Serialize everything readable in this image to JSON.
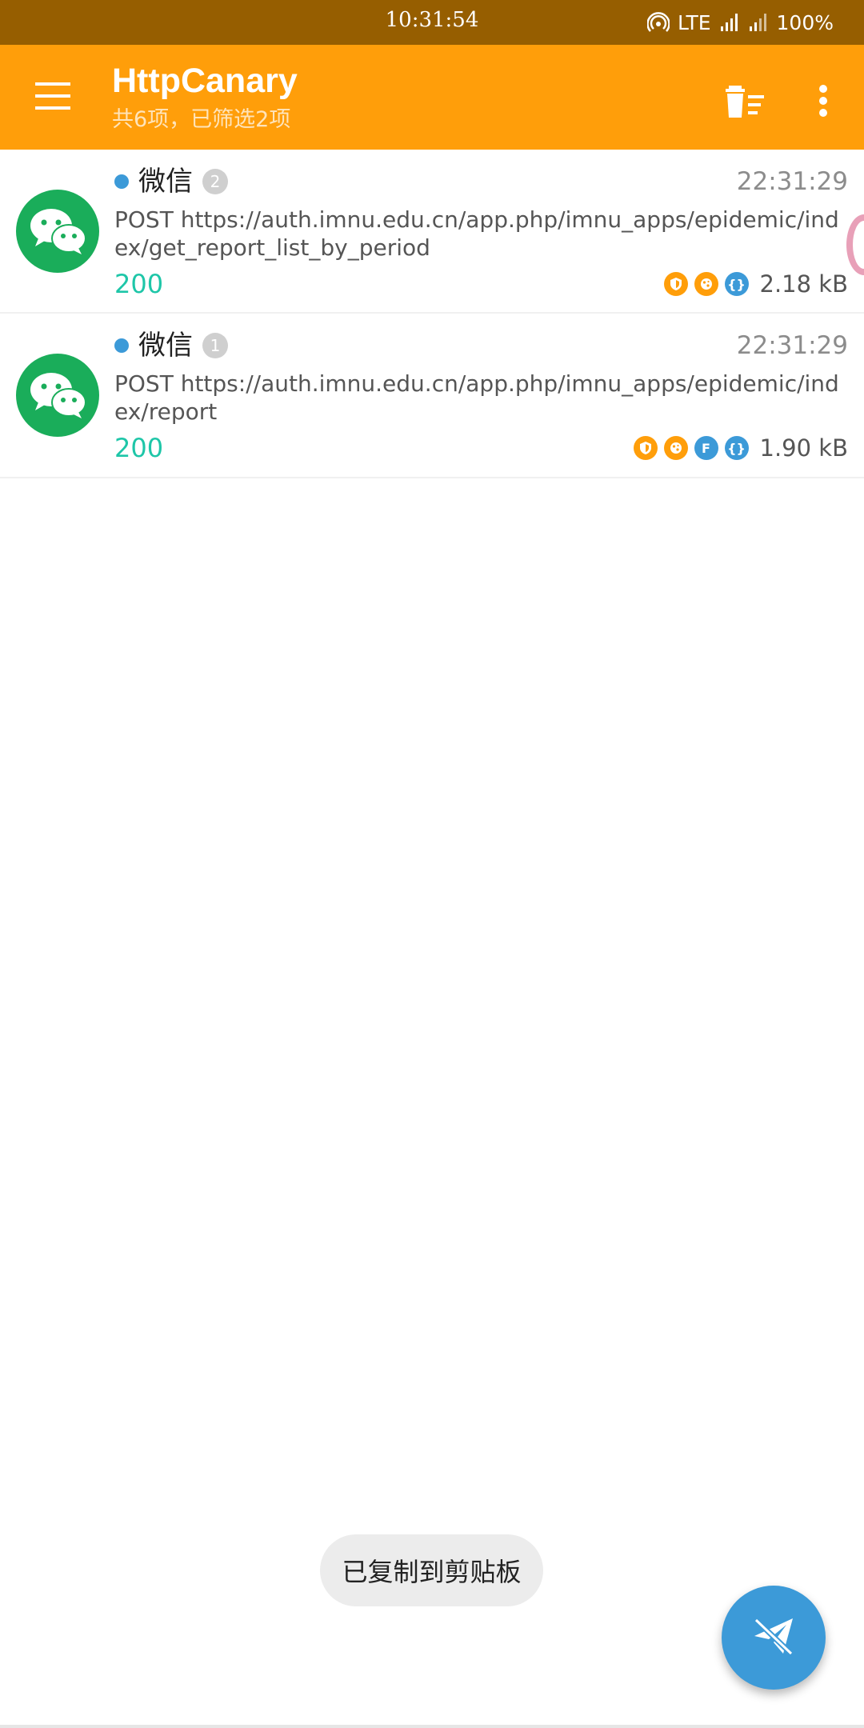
{
  "colors": {
    "status_bar": "#965e00",
    "toolbar": "#ff9e0a",
    "wechat_green": "#1aad5a",
    "accent_blue": "#3c9ad8",
    "status_code": "#1ec6a8"
  },
  "status_bar": {
    "time": "10:31:54",
    "network": "LTE",
    "battery": "100%",
    "icons": [
      "hotspot-icon",
      "signal-icon",
      "signal-icon"
    ]
  },
  "toolbar": {
    "title": "HttpCanary",
    "subtitle": "共6项，已筛选2项",
    "menu_icon": "hamburger-menu-icon",
    "delete_icon": "clear-list-icon",
    "more_icon": "more-vertical-icon"
  },
  "requests": [
    {
      "app": "微信",
      "count": "2",
      "time": "22:31:29",
      "url": "POST https://auth.imnu.edu.cn/app.php/imnu_apps/epidemic/index/get_report_list_by_period",
      "status": "200",
      "tags": [
        "ssl",
        "cookie",
        "json"
      ],
      "size": "2.18 kB"
    },
    {
      "app": "微信",
      "count": "1",
      "time": "22:31:29",
      "url": "POST https://auth.imnu.edu.cn/app.php/imnu_apps/epidemic/index/report",
      "status": "200",
      "tags": [
        "ssl",
        "cookie",
        "form",
        "json"
      ],
      "size": "1.90 kB"
    }
  ],
  "tag_labels": {
    "form": "F",
    "json": "{}"
  },
  "toast": "已复制到剪贴板",
  "fab_icon": "capture-off-icon"
}
